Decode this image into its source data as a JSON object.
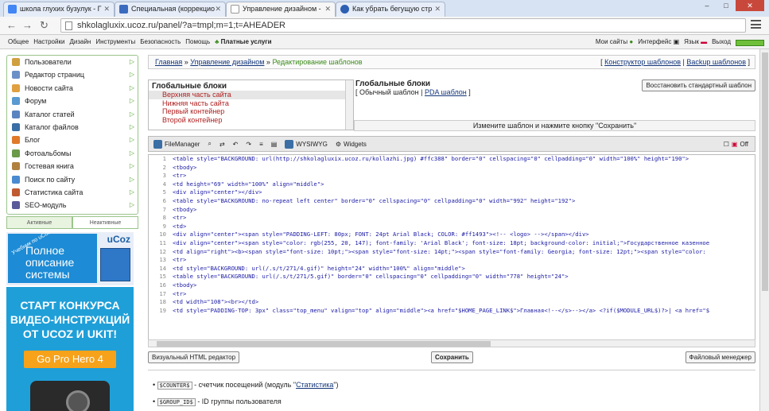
{
  "browser": {
    "tabs": [
      {
        "label": "школа глухих бузулук - Г",
        "icon": "google-icon",
        "active": false
      },
      {
        "label": "Специальная (коррекцио",
        "icon": "site-icon",
        "active": false
      },
      {
        "label": "Управление дизайном -",
        "icon": "page-icon",
        "active": true
      },
      {
        "label": "Как убрать бегущую стр",
        "icon": "ucoz-icon",
        "active": false
      }
    ],
    "url": "shkolagluxix.ucoz.ru/panel/?a=tmpl;m=1;t=AHEADER",
    "window_buttons": [
      "–",
      "□",
      "✕"
    ]
  },
  "ucozbar": {
    "left_menu": [
      "Общее",
      "Настройки",
      "Дизайн",
      "Инструменты",
      "Безопасность",
      "Помощь"
    ],
    "paid": "Платные услуги",
    "my_sites": "Мои сайты",
    "interface": "Интерфейс",
    "language": "Язык",
    "exit": "Выход",
    "progress": 1.0
  },
  "sidebar": {
    "items": [
      {
        "label": "Пользователи",
        "icon": "users-icon",
        "color": "#d0a040"
      },
      {
        "label": "Редактор страниц",
        "icon": "page-editor-icon",
        "color": "#6b8fc7"
      },
      {
        "label": "Новости сайта",
        "icon": "news-icon",
        "color": "#e0a040"
      },
      {
        "label": "Форум",
        "icon": "forum-icon",
        "color": "#5a9ad0"
      },
      {
        "label": "Каталог статей",
        "icon": "articles-icon",
        "color": "#5a84c0"
      },
      {
        "label": "Каталог файлов",
        "icon": "files-icon",
        "color": "#3a6ea5"
      },
      {
        "label": "Блог",
        "icon": "blog-icon",
        "color": "#e07a2a"
      },
      {
        "label": "Фотоальбомы",
        "icon": "photo-icon",
        "color": "#6a9a4a"
      },
      {
        "label": "Гостевая книга",
        "icon": "guestbook-icon",
        "color": "#b08040"
      },
      {
        "label": "Поиск по сайту",
        "icon": "search-icon",
        "color": "#4a8ad0"
      },
      {
        "label": "Статистика сайта",
        "icon": "stats-icon",
        "color": "#c05a30"
      },
      {
        "label": "SEO-модуль",
        "icon": "seo-icon",
        "color": "#5a5a9a"
      }
    ],
    "tab_active": "Активные",
    "tab_inactive": "Неактивные"
  },
  "ads": {
    "book_text": "Учебник по uCoz",
    "book_title": "Полное описание системы",
    "brand": "uCoz",
    "contest": "СТАРТ КОНКУРСА ВИДЕО-ИНСТРУКЦИЙ ОТ UCOZ И UKIT!",
    "prize": "Go Pro Hero 4"
  },
  "breadcrumb": {
    "home": "Главная",
    "sep": " » ",
    "design": "Управление дизайном",
    "current": "Редактирование шаблонов",
    "builder": "Конструктор шаблонов",
    "backup": "Backup шаблонов"
  },
  "blocks": {
    "heading": "Глобальные блоки",
    "items": [
      "Верхняя часть сайта",
      "Нижняя часть сайта",
      "Первый контейнер",
      "Второй контейнер"
    ],
    "title": "Глобальные блоки",
    "normal": "Обычный шаблон",
    "pda": "PDA шаблон",
    "restore": "Восстановить стандартный шаблон",
    "hint": "Измените шаблон и нажмите кнопку \"Сохранить\""
  },
  "toolbar": {
    "filemanager": "FileManager",
    "wysiwyg": "WYSIWYG",
    "widgets": "Widgets",
    "off": "Off"
  },
  "code_lines": [
    "<table style=\"BACKGROUND: url(http://shkolagluxix.ucoz.ru/kollazhi.jpg) #ffc388\" border=\"0\" cellspacing=\"0\" cellpadding=\"0\" width=\"100%\" height=\"190\">",
    "<tbody>",
    "<tr>",
    "<td height=\"69\" width=\"100%\" align=\"middle\">",
    "<div align=\"center\"></div>",
    "<table style=\"BACKGROUND: no-repeat left center\" border=\"0\" cellspacing=\"0\" cellpadding=\"0\" width=\"992\" height=\"192\">",
    "<tbody>",
    "<tr>",
    "<td>",
    "<div align=\"center\"><span style=\"PADDING-LEFT: 80px; FONT: 24pt Arial Black; COLOR: #ff1493\"><!-- <logo> --></span></div>",
    "<div align=\"center\"><span style=\"color: rgb(255, 20, 147); font-family: 'Arial Black'; font-size: 18pt; background-color: initial;\">Государственное казенное",
    "<td align=\"right\"><b><span style=\"font-size: 10pt;\"><span style=\"font-size: 14pt;\"><span style=\"font-family: Georgia; font-size: 12pt;\"><span style=\"color:",
    "<tr>",
    "<td style=\"BACKGROUND: url(/.s/t/271/4.gif)\" height=\"24\" width=\"100%\" align=\"middle\">",
    "<table style=\"BACKGROUND: url(/.s/t/271/5.gif)\" border=\"0\" cellspacing=\"0\" cellpadding=\"0\" width=\"778\" height=\"24\">",
    "<tbody>",
    "<tr>",
    "<td width=\"108\"><br></td>",
    "<td style=\"PADDING-TOP: 3px\" class=\"top_menu\" valign=\"top\" align=\"middle\"><a href=\"$HOME_PAGE_LINK$\">Главная<!--</s>--></a> <?if($MODULE_URL$)?>| <a href=\"$"
  ],
  "buttons": {
    "visual": "Визуальный HTML редактор",
    "save": "Сохранить",
    "filemanager": "Файловый менеджер"
  },
  "vars": [
    {
      "code": "$COUNTER$",
      "desc": " - счетчик посещений (модуль \"",
      "link": "Статистика",
      "tail": "\")"
    },
    {
      "code": "$GROUP_ID$",
      "desc": " - ID группы пользователя",
      "link": "",
      "tail": ""
    }
  ]
}
